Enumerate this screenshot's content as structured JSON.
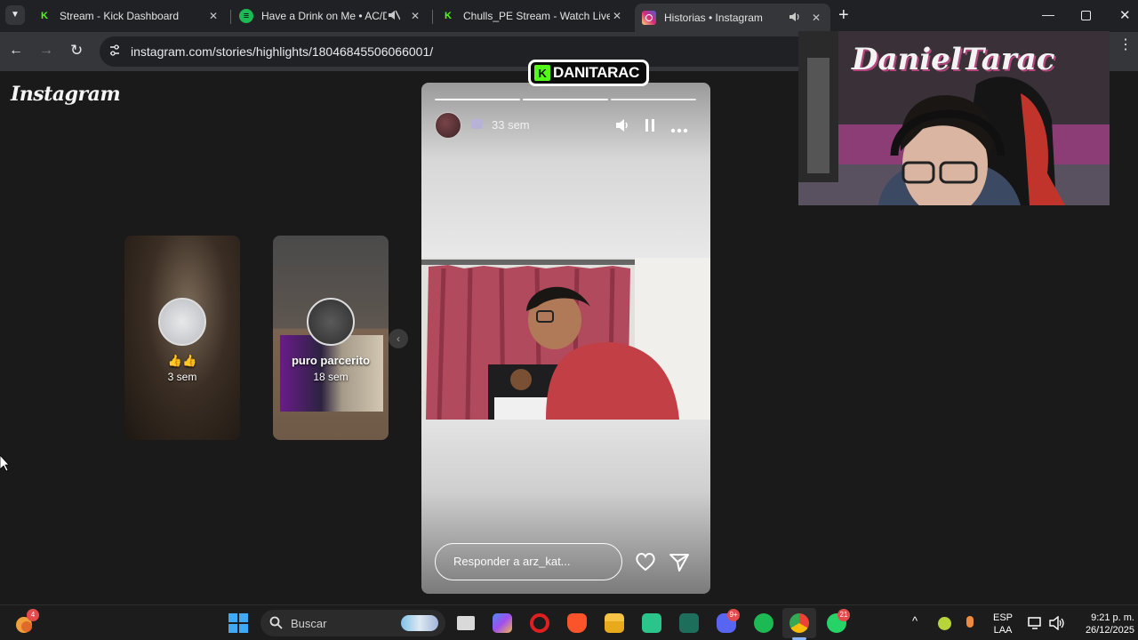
{
  "browser": {
    "tabs": [
      {
        "title": "Stream - Kick Dashboard",
        "icon": "kick-icon",
        "color": "#53fc18"
      },
      {
        "title": "Have a Drink on Me • AC/DC",
        "icon": "spotify-icon",
        "color": "#1db954"
      },
      {
        "title": "Chulls_PE Stream - Watch Live o",
        "icon": "kick-icon",
        "color": "#53fc18"
      },
      {
        "title": "Historias • Instagram",
        "icon": "instagram-icon",
        "color": "#e1306c",
        "active": true
      }
    ],
    "url": "instagram.com/stories/highlights/18046845506066001/"
  },
  "instagram": {
    "logo": "Instagram",
    "highlights": [
      {
        "name": "👍👍",
        "time": "3 sem"
      },
      {
        "name": "puro parcerito",
        "time": "18 sem"
      }
    ],
    "story": {
      "time": "33 sem",
      "reply_placeholder": "Responder a arz_kat..."
    }
  },
  "overlay": {
    "kick_username": "DANITARAC",
    "webcam_banner": "DanielTarac"
  },
  "taskbar": {
    "search_label": "Buscar",
    "discord_badge": "9+",
    "whatsapp_badge": "21",
    "widget_badge": "4",
    "lang_line1": "ESP",
    "lang_line2": "LAA",
    "time": "9:21 p. m.",
    "date": "26/12/2025"
  }
}
